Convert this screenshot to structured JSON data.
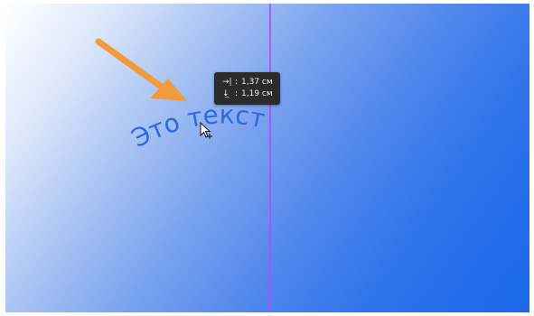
{
  "canvas": {
    "gradient_start": "#ffffff",
    "gradient_end": "#1967e8",
    "guide_color": "#b34cf5"
  },
  "annotation": {
    "arrow_color": "#f39a3c",
    "arrow_icon": "arrow-down-right-icon"
  },
  "text_layer": {
    "content": "Это текст",
    "color": "#2e67e6"
  },
  "measure_tooltip": {
    "horizontal_icon": "indent-horizontal-icon",
    "horizontal_value": "1,37 см",
    "vertical_icon": "indent-vertical-icon",
    "vertical_value": "1,19 см"
  },
  "cursor": {
    "icon": "move-cursor-icon"
  }
}
